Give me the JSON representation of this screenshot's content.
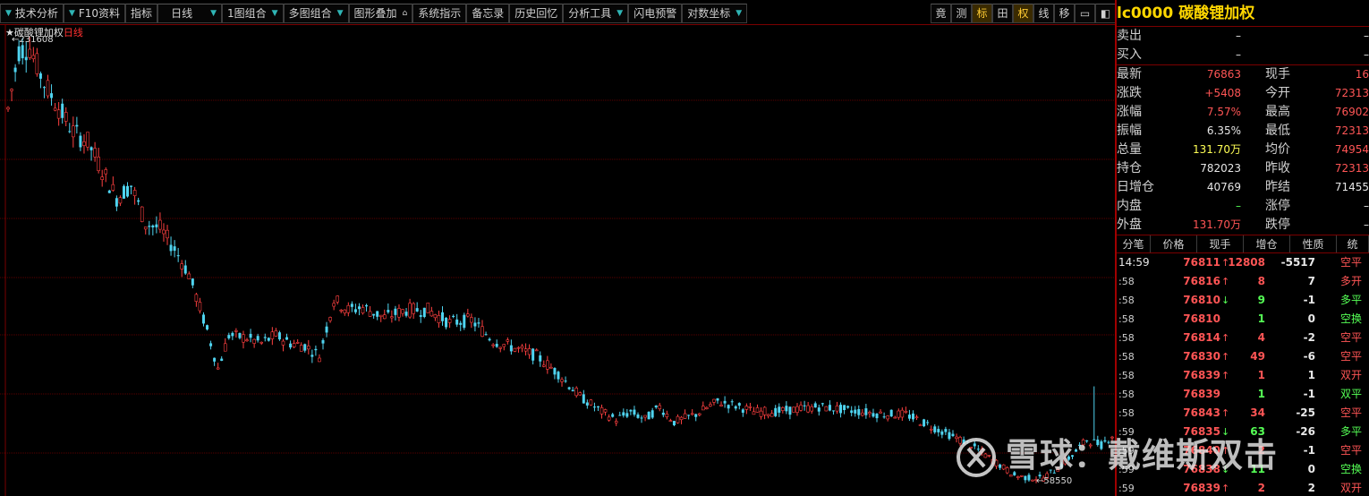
{
  "toolbar": {
    "items": [
      "技术分析",
      "F10资料",
      "指标",
      "日线",
      "1图组合",
      "多图组合",
      "图形叠加",
      "系统指示",
      "备忘录",
      "历史回忆",
      "分析工具",
      "闪电预警",
      "对数坐标"
    ],
    "right": [
      "竟",
      "测",
      "标",
      "田",
      "权",
      "线",
      "移",
      "▭",
      "◧"
    ]
  },
  "chart": {
    "title": "★碳酸锂加权",
    "period": "日线",
    "high_label": "231608",
    "low_label": "58550"
  },
  "chart_data": {
    "type": "candlestick",
    "title": "碳酸锂加权 日线",
    "max": 231608,
    "min": 58550,
    "ylim": [
      58550,
      231608
    ],
    "grid": true
  },
  "header": {
    "code": "lc0000",
    "name": "碳酸锂加权"
  },
  "quote": {
    "rows": [
      {
        "l": "卖出",
        "v": "–",
        "l2": "",
        "v2": "–"
      },
      {
        "l": "买入",
        "v": "–",
        "l2": "",
        "v2": "–"
      },
      {
        "l": "最新",
        "v": "76863",
        "l2": "现手",
        "v2": "16"
      },
      {
        "l": "涨跌",
        "v": "+5408",
        "l2": "今开",
        "v2": "72313"
      },
      {
        "l": "涨幅",
        "v": "7.57%",
        "l2": "最高",
        "v2": "76902"
      },
      {
        "l": "振幅",
        "v": "6.35%",
        "l2": "最低",
        "v2": "72313"
      },
      {
        "l": "总量",
        "v": "131.70万",
        "l2": "均价",
        "v2": "74954"
      },
      {
        "l": "持仓",
        "v": "782023",
        "l2": "昨收",
        "v2": "72313"
      },
      {
        "l": "日增仓",
        "v": "40769",
        "l2": "昨结",
        "v2": "71455"
      },
      {
        "l": "内盘",
        "v": "–",
        "l2": "涨停",
        "v2": "–"
      },
      {
        "l": "外盘",
        "v": "131.70万",
        "l2": "跌停",
        "v2": "–"
      }
    ]
  },
  "detail": {
    "headers": [
      "分笔",
      "价格",
      "现手",
      "增仓",
      "性质",
      "统"
    ],
    "rows": [
      {
        "t": "14:59",
        "p": "76811",
        "d": "up",
        "q": "12808",
        "z": "-5517",
        "n": "空平",
        "nc": "red"
      },
      {
        "t": ":58",
        "p": "76816",
        "d": "up",
        "q": "8",
        "z": "7",
        "n": "多开",
        "nc": "red"
      },
      {
        "t": ":58",
        "p": "76810",
        "d": "down",
        "q": "9",
        "z": "-1",
        "n": "多平",
        "nc": "grn"
      },
      {
        "t": ":58",
        "p": "76810",
        "d": "",
        "q": "1",
        "z": "0",
        "n": "空换",
        "nc": "grn"
      },
      {
        "t": ":58",
        "p": "76814",
        "d": "up",
        "q": "4",
        "z": "-2",
        "n": "空平",
        "nc": "red"
      },
      {
        "t": ":58",
        "p": "76830",
        "d": "up",
        "q": "49",
        "z": "-6",
        "n": "空平",
        "nc": "red"
      },
      {
        "t": ":58",
        "p": "76839",
        "d": "up",
        "q": "1",
        "z": "1",
        "n": "双开",
        "nc": "red"
      },
      {
        "t": ":58",
        "p": "76839",
        "d": "",
        "q": "1",
        "z": "-1",
        "n": "双平",
        "nc": "grn"
      },
      {
        "t": ":58",
        "p": "76843",
        "d": "up",
        "q": "34",
        "z": "-25",
        "n": "空平",
        "nc": "red"
      },
      {
        "t": ":59",
        "p": "76835",
        "d": "down",
        "q": "63",
        "z": "-26",
        "n": "多平",
        "nc": "grn"
      },
      {
        "t": ":59",
        "p": "76840",
        "d": "up",
        "q": "2",
        "z": "-1",
        "n": "空平",
        "nc": "red"
      },
      {
        "t": ":59",
        "p": "76838",
        "d": "down",
        "q": "11",
        "z": "0",
        "n": "空换",
        "nc": "grn"
      },
      {
        "t": ":59",
        "p": "76839",
        "d": "up",
        "q": "2",
        "z": "2",
        "n": "双开",
        "nc": "red"
      }
    ]
  },
  "watermark": "雪球：戴维斯双击"
}
